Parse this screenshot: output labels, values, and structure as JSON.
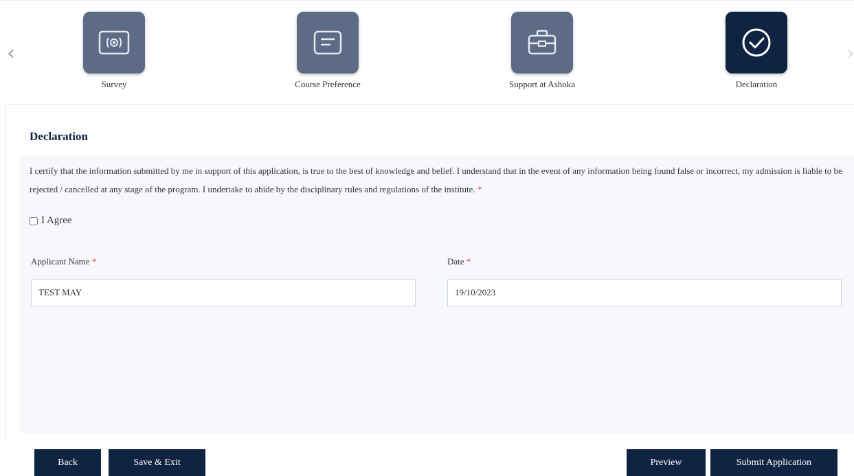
{
  "stepper": {
    "steps": [
      {
        "label": "Survey",
        "icon": "radio-icon"
      },
      {
        "label": "Course Preference",
        "icon": "document-icon"
      },
      {
        "label": "Support at Ashoka",
        "icon": "briefcase-icon"
      },
      {
        "label": "Declaration",
        "icon": "check-circle-icon",
        "active": true
      }
    ],
    "colors": {
      "inactive": "#5d6b86",
      "active": "#0f2442"
    }
  },
  "section": {
    "title": "Declaration",
    "declaration_text": "I certify that the information submitted by me in support of this application, is true to the best of knowledge and belief. I understand that in the event of any information being found false or incorrect, my admission is liable to be rejected / cancelled at any stage of the program. I undertake to abide by the disciplinary rules and regulations of the institute.",
    "required_marker": "*",
    "agree_label": "I Agree",
    "agree_checked": false
  },
  "fields": {
    "applicant_name": {
      "label": "Applicant Name",
      "value": "TEST MAY"
    },
    "date": {
      "label": "Date",
      "value": "19/10/2023"
    }
  },
  "buttons": {
    "back": "Back",
    "save_exit": "Save & Exit",
    "preview": "Preview",
    "submit": "Submit Application"
  },
  "theme": {
    "navy": "#0f2442",
    "required": "#e04848",
    "panel_bg": "#f6f8fc"
  }
}
